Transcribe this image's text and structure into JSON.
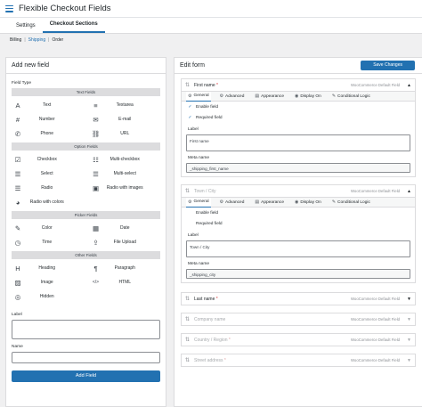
{
  "app": {
    "title": "Flexible Checkout Fields"
  },
  "tabs": [
    {
      "label": "Settings"
    },
    {
      "label": "Checkout Sections"
    }
  ],
  "subnav": [
    {
      "label": "Billing"
    },
    {
      "label": "Shipping"
    },
    {
      "label": "Order"
    }
  ],
  "left": {
    "title": "Add new field",
    "field_type_label": "Field Type",
    "groups": [
      {
        "title": "Text Fields",
        "items": [
          {
            "label": "Text",
            "icon": "A"
          },
          {
            "label": "Textarea",
            "icon": "≡"
          },
          {
            "label": "Number",
            "icon": "#"
          },
          {
            "label": "E-mail",
            "icon": "✉"
          },
          {
            "label": "Phone",
            "icon": "✆"
          },
          {
            "label": "URL",
            "icon": "⛓"
          }
        ]
      },
      {
        "title": "Option Fields",
        "items": [
          {
            "label": "Checkbox",
            "icon": "☑"
          },
          {
            "label": "Multi-checkbox",
            "icon": "☷"
          },
          {
            "label": "Select",
            "icon": "☰"
          },
          {
            "label": "Multi-select",
            "icon": "☰"
          },
          {
            "label": "Radio",
            "icon": "☰"
          },
          {
            "label": "Radio with images",
            "icon": "▣"
          },
          {
            "label": "Radio with colors",
            "icon": "◕"
          }
        ]
      },
      {
        "title": "Picker Fields",
        "items": [
          {
            "label": "Color",
            "icon": "✎"
          },
          {
            "label": "Date",
            "icon": "▦"
          },
          {
            "label": "Time",
            "icon": "◷"
          },
          {
            "label": "File Upload",
            "icon": "⇪"
          }
        ]
      },
      {
        "title": "Other Fields",
        "items": [
          {
            "label": "Heading",
            "icon": "H"
          },
          {
            "label": "Paragraph",
            "icon": "¶"
          },
          {
            "label": "Image",
            "icon": "▨"
          },
          {
            "label": "HTML",
            "icon": "</>"
          },
          {
            "label": "Hidden",
            "icon": "◎"
          }
        ]
      }
    ],
    "label_label": "Label",
    "name_label": "Name",
    "add_button": "Add Field"
  },
  "right": {
    "title": "Edit form",
    "save_button": "Save Changes",
    "editor_tabs": [
      "General",
      "Advanced",
      "Appearance",
      "Display On",
      "Conditional Logic"
    ],
    "editor_tab_icons": [
      "⚙",
      "⚙",
      "▤",
      "◉",
      "✎"
    ],
    "enable_label": "Enable field",
    "required_label": "Required field",
    "label_label": "Label",
    "meta_label": "Meta name",
    "default_tag": "WooCommerce Default Field",
    "fields": [
      {
        "name": "First name",
        "required": "*",
        "label_value": "First name",
        "meta_value": "_shipping_first_name",
        "dim": false
      },
      {
        "name": "Town / City",
        "required": "",
        "label_value": "Town / City",
        "meta_value": "_shipping_city",
        "dim": true
      },
      {
        "name": "Last name",
        "required": "*",
        "dim": false
      },
      {
        "name": "Company name",
        "required": "",
        "dim": true
      },
      {
        "name": "Country / Region",
        "required": "*",
        "dim": true
      },
      {
        "name": "Street address",
        "required": "*",
        "dim": true
      }
    ]
  }
}
